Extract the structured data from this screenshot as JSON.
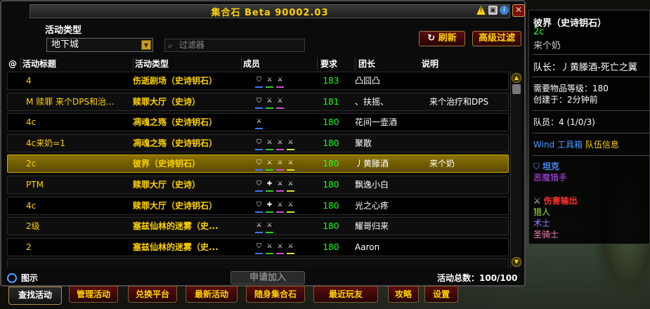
{
  "window": {
    "title": "集合石 Beta 90002.03"
  },
  "activity_type_label": "活动类型",
  "dropdown_value": "地下城",
  "filter_placeholder": "过滤器",
  "refresh_label": "刷新",
  "advanced_filter_label": "高级过滤",
  "columns": {
    "at": "@",
    "title": "活动标题",
    "type": "活动类型",
    "members": "成员",
    "req": "要求",
    "leader": "团长",
    "note": "说明"
  },
  "rows": [
    {
      "title": "4",
      "type": "伤逝剧场（史诗钥石）",
      "members": [
        "tank",
        "dps",
        "dps"
      ],
      "req": "183",
      "leader": "凸囧凸",
      "note": ""
    },
    {
      "title": "M 赎罪 来个DPS和治...",
      "type": "赎罪大厅（史诗）",
      "members": [
        "tank",
        "dps",
        "dps"
      ],
      "req": "181",
      "leader": "、扶摇、",
      "note": "来个治疗和DPS"
    },
    {
      "title": "4c",
      "type": "凋魂之殇（史诗钥石）",
      "members": [
        "dps"
      ],
      "req": "180",
      "leader": "花间一壶酒",
      "note": ""
    },
    {
      "title": "4c来奶=1",
      "type": "凋魂之殇（史诗钥石）",
      "members": [
        "tank",
        "dps",
        "dps",
        "dps"
      ],
      "req": "180",
      "leader": "聚散",
      "note": ""
    },
    {
      "title": "2c",
      "type": "彼界（史诗钥石）",
      "members": [
        "tank",
        "dps",
        "dps",
        "dps"
      ],
      "req": "180",
      "leader": "丿黄滕酒",
      "note": "来个奶"
    },
    {
      "title": "PTM",
      "type": "赎罪大厅（史诗）",
      "members": [
        "tank",
        "heal",
        "dps",
        "dps"
      ],
      "req": "180",
      "leader": "飘逸小白",
      "note": ""
    },
    {
      "title": "4c",
      "type": "赎罪大厅（史诗钥石）",
      "members": [
        "tank",
        "heal",
        "dps",
        "dps"
      ],
      "req": "180",
      "leader": "光之心疼",
      "note": ""
    },
    {
      "title": "2级",
      "type": "塞兹仙林的迷雾（史...",
      "members": [
        "dps",
        "dps"
      ],
      "req": "180",
      "leader": "耀哥归来",
      "note": ""
    },
    {
      "title": "2",
      "type": "塞兹仙林的迷雾（史...",
      "members": [
        "tank",
        "dps",
        "dps",
        "dps"
      ],
      "req": "180",
      "leader": "Aaron",
      "note": ""
    },
    {
      "title": "...",
      "type": "...",
      "members": [],
      "req": "",
      "leader": "...",
      "note": ""
    }
  ],
  "footer": {
    "icons_label": "图示",
    "apply_label": "申请加入",
    "total": "活动总数：100/100"
  },
  "tabs": [
    "查找活动",
    "管理活动",
    "兑换平台",
    "最新活动",
    "随身集合石",
    "最近玩友",
    "攻略",
    "设置"
  ],
  "detail": {
    "dungeon": "彼界（史诗钥石）",
    "title": "2c",
    "note": "来个奶",
    "leader": "队长：丿黄滕酒-死亡之翼",
    "ilvl": "需要物品等级：180",
    "created": "创建于：2分钟前",
    "members": "队员：4 (1/0/3)",
    "toolbox_prefix": "Wind",
    "toolbox_mid": "工具箱",
    "toolbox_suffix": "队伍信息",
    "tank_header": "坦克",
    "tank_member": "恶魔猎手",
    "dps_header": "伤害输出",
    "dps_members": [
      "猎人",
      "术士",
      "圣骑士"
    ]
  },
  "colors": {
    "gold": "#ffd200",
    "req_green": "#20ff20",
    "tank": "#4a8cff",
    "dps": "#ff3030",
    "heal": "#20c020"
  }
}
